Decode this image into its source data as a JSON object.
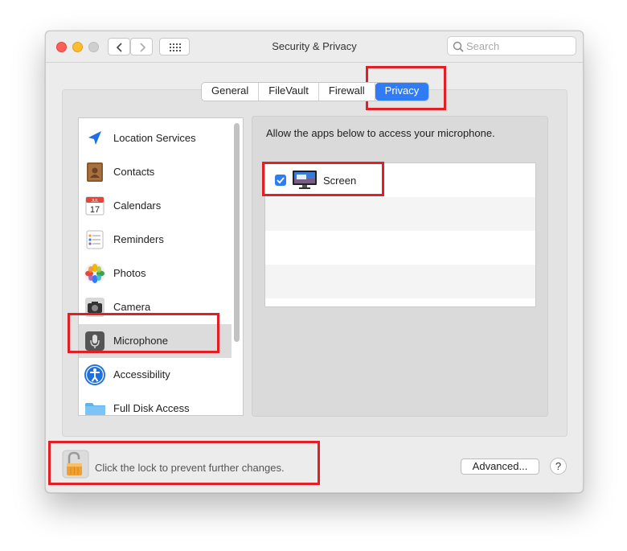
{
  "window": {
    "title": "Security & Privacy"
  },
  "search": {
    "placeholder": "Search"
  },
  "tabs": [
    {
      "label": "General",
      "active": false
    },
    {
      "label": "FileVault",
      "active": false
    },
    {
      "label": "Firewall",
      "active": false
    },
    {
      "label": "Privacy",
      "active": true
    }
  ],
  "sidebar": {
    "items": [
      {
        "label": "Location Services",
        "icon": "location-arrow-icon"
      },
      {
        "label": "Contacts",
        "icon": "contacts-book-icon"
      },
      {
        "label": "Calendars",
        "icon": "calendar-icon",
        "icon_month": "JUL",
        "icon_day": "17"
      },
      {
        "label": "Reminders",
        "icon": "reminders-list-icon"
      },
      {
        "label": "Photos",
        "icon": "photos-flower-icon"
      },
      {
        "label": "Camera",
        "icon": "camera-icon"
      },
      {
        "label": "Microphone",
        "icon": "microphone-icon",
        "selected": true
      },
      {
        "label": "Accessibility",
        "icon": "accessibility-icon"
      },
      {
        "label": "Full Disk Access",
        "icon": "folder-icon"
      }
    ]
  },
  "main": {
    "description": "Allow the apps below to access your microphone.",
    "apps": [
      {
        "label": "Screen",
        "checked": true,
        "icon": "screen-monitor-icon"
      }
    ]
  },
  "footer": {
    "lock_text": "Click the lock to prevent further changes.",
    "advanced_label": "Advanced...",
    "help_label": "?"
  },
  "colors": {
    "accent": "#2f7cf6",
    "highlight": "#e31e24"
  }
}
